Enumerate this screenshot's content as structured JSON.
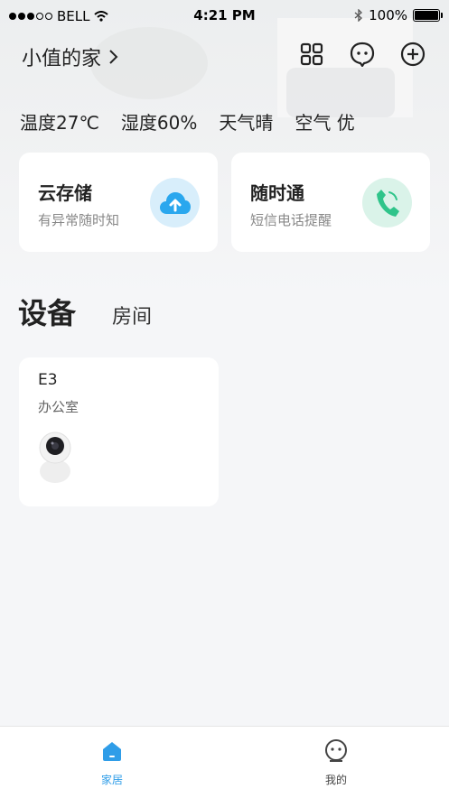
{
  "status_bar": {
    "carrier": "BELL",
    "time": "4:21 PM",
    "battery": "100%"
  },
  "header": {
    "home_name": "小值的家",
    "icons": [
      "grid-icon",
      "message-icon",
      "add-icon"
    ]
  },
  "weather": {
    "temperature": "温度27℃",
    "humidity": "湿度60%",
    "weather": "天气晴",
    "air": "空气 优"
  },
  "services": [
    {
      "title": "云存储",
      "subtitle": "有异常随时知",
      "icon": "cloud-upload-icon",
      "color": "#2aa7ee",
      "bg": "#d8eefb"
    },
    {
      "title": "随时通",
      "subtitle": "短信电话提醒",
      "icon": "phone-icon",
      "color": "#2fc48a",
      "bg": "#daf3e9"
    }
  ],
  "tabs": {
    "devices": "设备",
    "rooms": "房间"
  },
  "devices": [
    {
      "name": "E3",
      "room": "办公室",
      "icon": "camera-icon"
    }
  ],
  "tabbar": {
    "home": "家居",
    "mine": "我的",
    "active_color": "#2f9de8"
  }
}
